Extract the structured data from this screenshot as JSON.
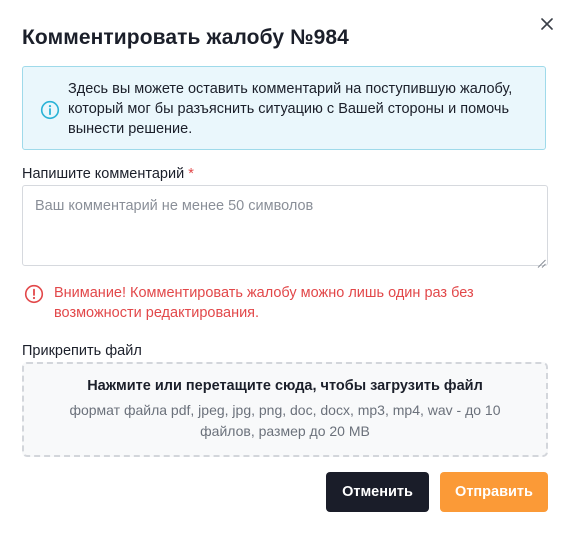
{
  "dialog": {
    "title": "Комментировать жалобу №984",
    "close_icon": "close-icon"
  },
  "info": {
    "icon": "info-icon",
    "accent_color": "#2bb3d6",
    "text": "Здесь вы можете оставить комментарий на поступившую жалобу, который мог бы разъяснить ситуацию с Вашей стороны и помочь вынести решение."
  },
  "comment": {
    "label": "Напишите комментарий",
    "required_mark": "*",
    "placeholder": "Ваш комментарий не менее 50 символов",
    "value": ""
  },
  "warning": {
    "icon": "alert-circle-icon",
    "color": "#e2484a",
    "text": "Внимание! Комментировать жалобу можно лишь один раз без возможности редактирования."
  },
  "attachment": {
    "label": "Прикрепить файл",
    "dropzone_title": "Нажмите или перетащите сюда, чтобы загрузить файл",
    "dropzone_hint": "формат файла pdf, jpeg, jpg, png, doc, docx, mp3, mp4, wav - до 10 файлов, размер до 20 MB"
  },
  "actions": {
    "cancel_label": "Отменить",
    "cancel_color": "#1a1d29",
    "submit_label": "Отправить",
    "submit_color": "#fb9a37"
  }
}
